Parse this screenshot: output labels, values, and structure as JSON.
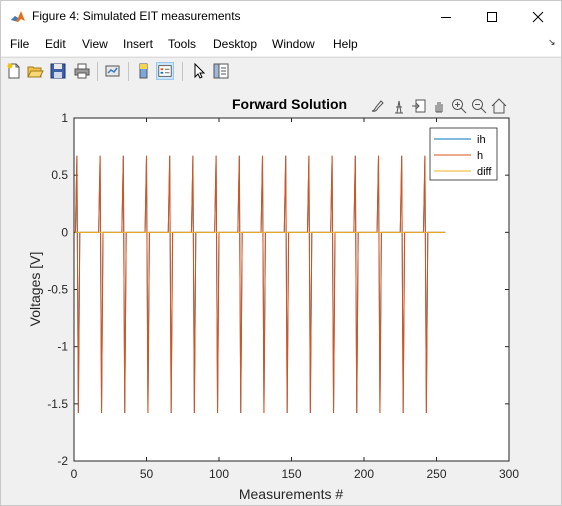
{
  "window": {
    "title": "Figure 4: Simulated EIT measurements"
  },
  "menu": [
    "File",
    "Edit",
    "View",
    "Insert",
    "Tools",
    "Desktop",
    "Window",
    "Help"
  ],
  "chart_data": {
    "type": "line",
    "title": "Forward Solution",
    "xlabel": "Measurements #",
    "ylabel": "Voltages [V]",
    "xlim": [
      0,
      300
    ],
    "ylim": [
      -2,
      1
    ],
    "xticks": [
      "0",
      "50",
      "100",
      "150",
      "200",
      "250",
      "300"
    ],
    "yticks": [
      "1",
      "0.5",
      "0",
      "-0.5",
      "-1",
      "-1.5",
      "-2"
    ],
    "grid": false,
    "legend_position": "top-right",
    "series": [
      {
        "name": "ih",
        "color": "#0072bd"
      },
      {
        "name": "h",
        "color": "#d95319"
      },
      {
        "name": "diff",
        "color": "#edb120"
      }
    ],
    "pattern": {
      "n_measurements": 256,
      "electrodes": 16,
      "period": 16,
      "spike_indices": [
        1,
        2,
        16,
        17
      ],
      "spike_values": [
        0.67,
        -1.58,
        -1.58,
        0.67
      ],
      "baseline": 0.0
    }
  }
}
